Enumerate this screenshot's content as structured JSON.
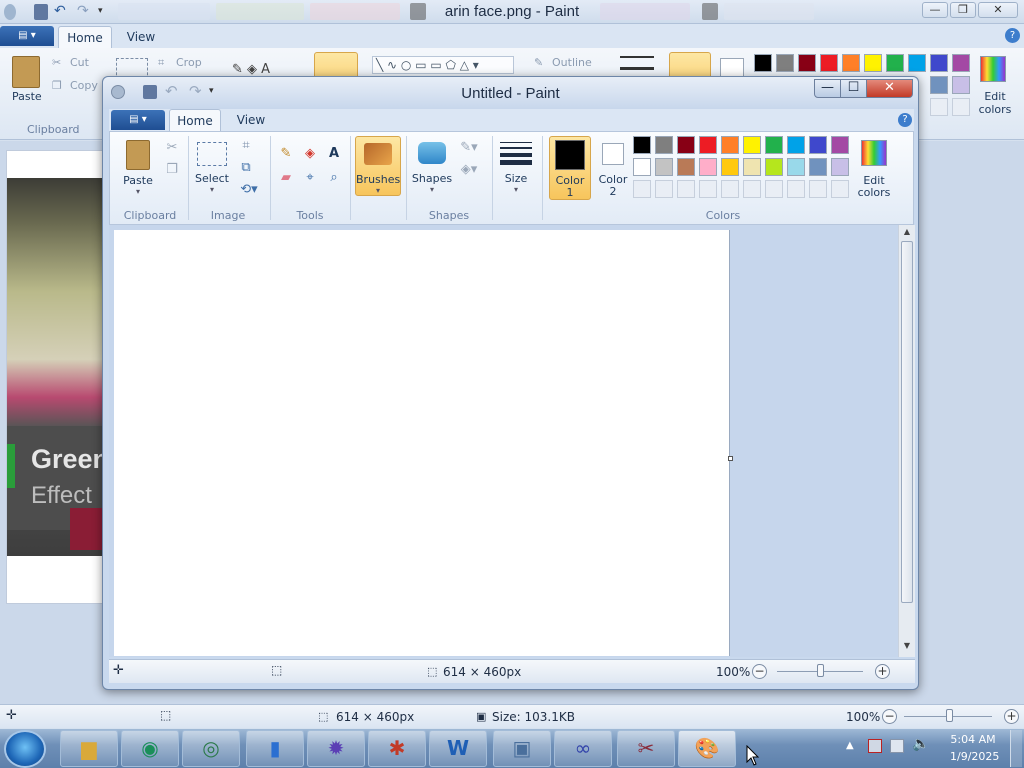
{
  "background_window": {
    "title": "arin face.png - Paint",
    "tabs": [
      "Home",
      "View"
    ],
    "clipboard": {
      "paste": "Paste",
      "cut": "Cut",
      "copy": "Copy",
      "group": "Clipboard"
    },
    "crop": "Crop",
    "outline": "Outline",
    "edit_colors": "Edit colors",
    "image_text_line1": "Green",
    "image_text_line2": "Effect",
    "status": {
      "dimensions": "614 × 460px",
      "size": "Size: 103.1KB",
      "zoom": "100%"
    }
  },
  "window": {
    "title": "Untitled - Paint",
    "tabs": {
      "home": "Home",
      "view": "View"
    },
    "ribbon": {
      "clipboard": {
        "paste": "Paste",
        "group": "Clipboard"
      },
      "image": {
        "select": "Select",
        "group": "Image"
      },
      "tools": {
        "group": "Tools"
      },
      "brushes": "Brushes",
      "shapes": {
        "label": "Shapes",
        "group": "Shapes"
      },
      "size": "Size",
      "color1": {
        "line1": "Color",
        "line2": "1",
        "value": "#000000"
      },
      "color2": {
        "line1": "Color",
        "line2": "2",
        "value": "#ffffff"
      },
      "colors_group": "Colors",
      "edit_colors": {
        "line1": "Edit",
        "line2": "colors"
      }
    },
    "palette_row1": [
      "#000000",
      "#7f7f7f",
      "#880015",
      "#ed1c24",
      "#ff7f27",
      "#fff200",
      "#22b14c",
      "#00a2e8",
      "#3f48cc",
      "#a349a4"
    ],
    "palette_row2": [
      "#ffffff",
      "#c3c3c3",
      "#b97a57",
      "#ffaec9",
      "#ffc90e",
      "#efe4b0",
      "#b5e61d",
      "#99d9ea",
      "#7092be",
      "#c8bfe7"
    ],
    "status": {
      "dimensions": "614 × 460px",
      "zoom": "100%"
    }
  },
  "taskbar": {
    "time": "5:04 AM",
    "date": "1/9/2025"
  }
}
